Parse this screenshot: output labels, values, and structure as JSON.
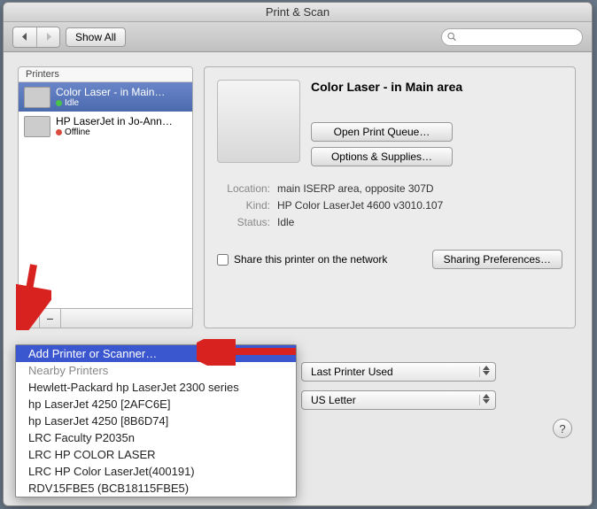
{
  "window": {
    "title": "Print & Scan"
  },
  "toolbar": {
    "show_all": "Show All",
    "search_placeholder": ""
  },
  "printers_header": "Printers",
  "printers": [
    {
      "name": "Color Laser - in Main…",
      "status": "Idle",
      "status_color": "green"
    },
    {
      "name": "HP LaserJet in Jo-Ann…",
      "status": "Offline",
      "status_color": "red"
    }
  ],
  "detail": {
    "title": "Color Laser - in Main area",
    "open_queue": "Open Print Queue…",
    "options_supplies": "Options & Supplies…",
    "location_label": "Location:",
    "location": "main ISERP area, opposite 307D",
    "kind_label": "Kind:",
    "kind": "HP Color LaserJet 4600 v3010.107",
    "status_label": "Status:",
    "status": "Idle",
    "share_label": "Share this printer on the network",
    "sharing_prefs": "Sharing Preferences…"
  },
  "menu": {
    "add": "Add Printer or Scanner…",
    "nearby_header": "Nearby Printers",
    "items": [
      "Hewlett-Packard hp LaserJet 2300 series",
      "hp LaserJet 4250 [2AFC6E]",
      "hp LaserJet 4250 [8B6D74]",
      "LRC Faculty P2035n",
      "LRC HP COLOR LASER",
      "LRC HP Color LaserJet(400191)",
      "RDV15FBE5 (BCB18115FBE5)"
    ]
  },
  "default_printer": {
    "value": "Last Printer Used"
  },
  "paper_size": {
    "value": "US Letter"
  }
}
